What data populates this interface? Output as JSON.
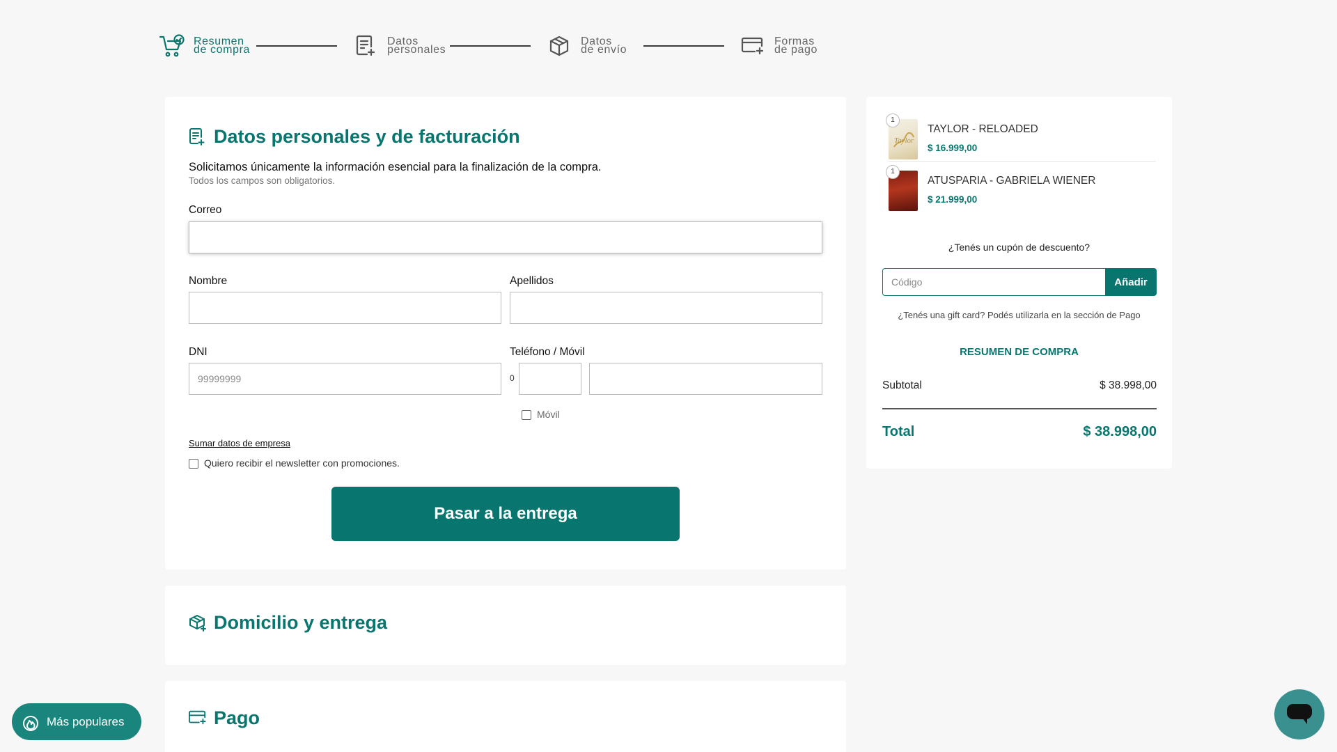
{
  "stepper": {
    "steps": [
      {
        "line1": "Resumen",
        "line2": "de compra",
        "icon": "cart-check-icon",
        "active": true
      },
      {
        "line1": "Datos",
        "line2": "personales",
        "icon": "document-add-icon",
        "active": false
      },
      {
        "line1": "Datos",
        "line2": "de envío",
        "icon": "box-icon",
        "active": false
      },
      {
        "line1": "Formas",
        "line2": "de pago",
        "icon": "card-add-icon",
        "active": false
      }
    ]
  },
  "personal": {
    "title": "Datos personales y de facturación",
    "intro": "Solicitamos únicamente la información esencial para la finalización de la compra.",
    "intro_sub": "Todos los campos son obligatorios.",
    "email_label": "Correo",
    "email_value": "",
    "name_label": "Nombre",
    "lastname_label": "Apellidos",
    "dni_label": "DNI",
    "dni_placeholder": "99999999",
    "phone_label": "Teléfono / Móvil",
    "phone_sep": "0",
    "mobile_label": "Móvil",
    "company_link": "Sumar datos de empresa",
    "newsletter_label": "Quiero recibir el newsletter con promociones.",
    "cta": "Pasar a la entrega"
  },
  "delivery": {
    "title": "Domicilio y entrega"
  },
  "payment": {
    "title": "Pago"
  },
  "cart": {
    "items": [
      {
        "qty": "1",
        "title": "TAYLOR - RELOADED",
        "price": "$ 16.999,00"
      },
      {
        "qty": "1",
        "title": "ATUSPARIA - GABRIELA WIENER",
        "price": "$ 21.999,00"
      }
    ],
    "coupon_question": "¿Tenés un cupón de descuento?",
    "coupon_placeholder": "Código",
    "coupon_button": "Añadir",
    "gift_note": "¿Tenés una gift card? Podés utilizarla en la sección de Pago",
    "summary_title": "RESUMEN DE COMPRA",
    "subtotal_label": "Subtotal",
    "subtotal_value": "$ 38.998,00",
    "total_label": "Total",
    "total_value": "$ 38.998,00"
  },
  "floating": {
    "popular_label": "Más populares"
  },
  "colors": {
    "accent": "#08766f",
    "background": "#f7f7f7"
  }
}
